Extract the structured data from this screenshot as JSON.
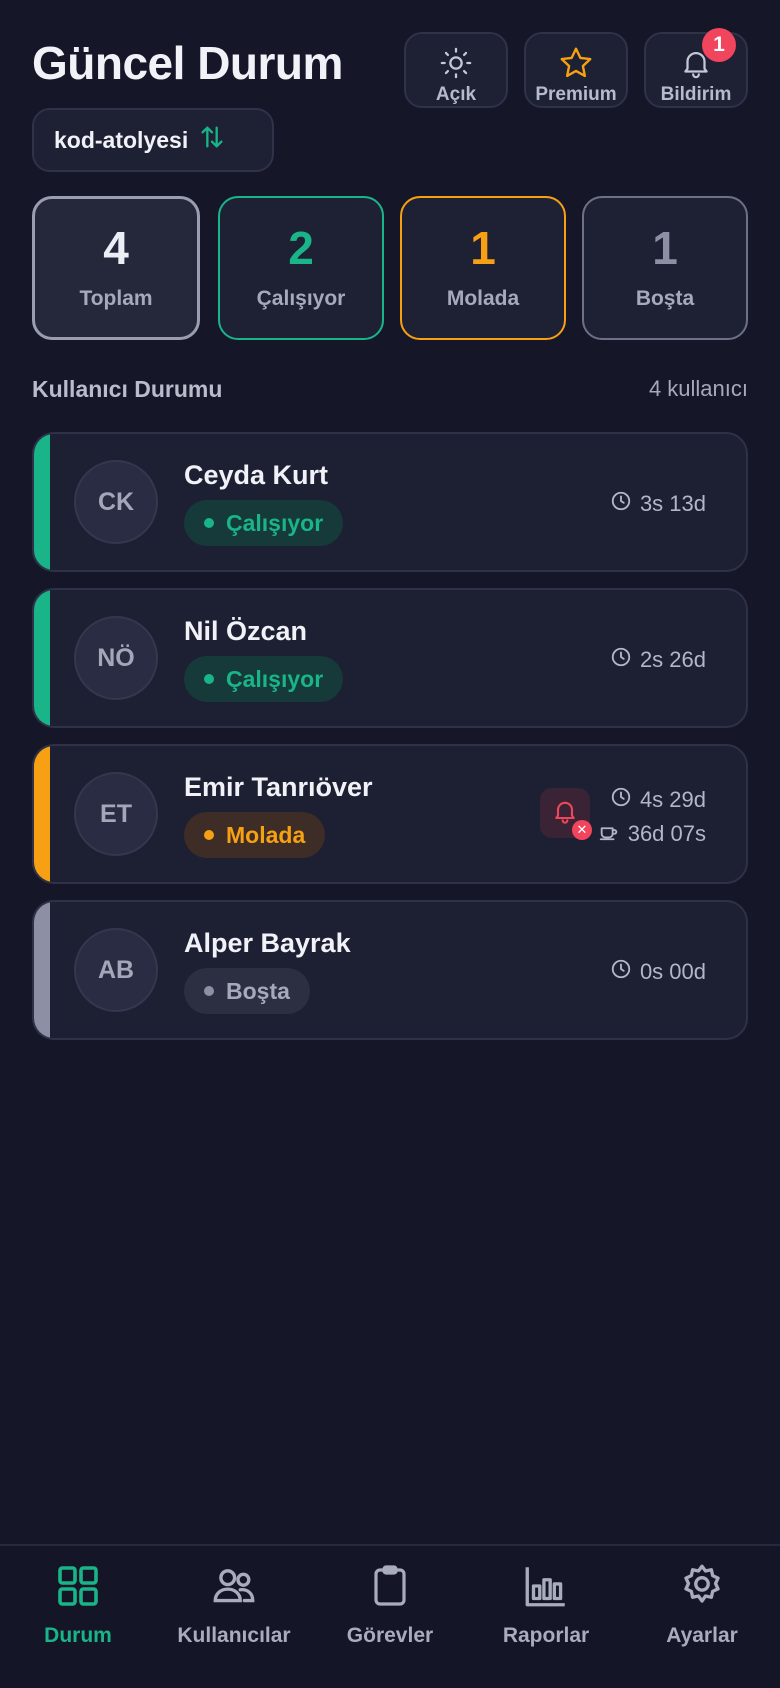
{
  "header": {
    "title": "Güncel Durum"
  },
  "top_buttons": [
    {
      "label": "Açık",
      "icon": "sun-icon"
    },
    {
      "label": "Premium",
      "icon": "star-icon"
    },
    {
      "label": "Bildirim",
      "icon": "bell-icon",
      "badge": "1"
    }
  ],
  "workspace": {
    "name": "kod-atolyesi",
    "icon": "swap-vertical-icon"
  },
  "stats": [
    {
      "value": "4",
      "label": "Toplam",
      "color": "#eceef6"
    },
    {
      "value": "2",
      "label": "Çalışıyor",
      "color": "#19b488"
    },
    {
      "value": "1",
      "label": "Molada",
      "color": "#f7a013"
    },
    {
      "value": "1",
      "label": "Boşta",
      "color": "#8d90a5"
    }
  ],
  "section": {
    "title": "Kullanıcı Durumu",
    "count": "4 kullanıcı"
  },
  "users": [
    {
      "initials": "CK",
      "name": "Ceyda Kurt",
      "status": "Çalışıyor",
      "time": "3s 13d",
      "color": "#19b488"
    },
    {
      "initials": "NÖ",
      "name": "Nil Özcan",
      "status": "Çalışıyor",
      "time": "2s 26d",
      "color": "#19b488"
    },
    {
      "initials": "ET",
      "name": "Emir Tanrıöver",
      "status": "Molada",
      "time": "4s 29d",
      "break_time": "36d 07s",
      "color": "#f7a013"
    },
    {
      "initials": "AB",
      "name": "Alper Bayrak",
      "status": "Boşta",
      "time": "0s 00d",
      "color": "#8d90a5"
    }
  ],
  "nav": [
    {
      "label": "Durum",
      "icon": "grid-icon",
      "active": true
    },
    {
      "label": "Kullanıcılar",
      "icon": "users-icon"
    },
    {
      "label": "Görevler",
      "icon": "clipboard-icon"
    },
    {
      "label": "Raporlar",
      "icon": "bar-chart-icon"
    },
    {
      "label": "Ayarlar",
      "icon": "gear-icon"
    }
  ],
  "colors": {
    "accent": "#19b488",
    "warning": "#f7a013",
    "danger": "#f0455c",
    "idle": "#8d90a5"
  }
}
